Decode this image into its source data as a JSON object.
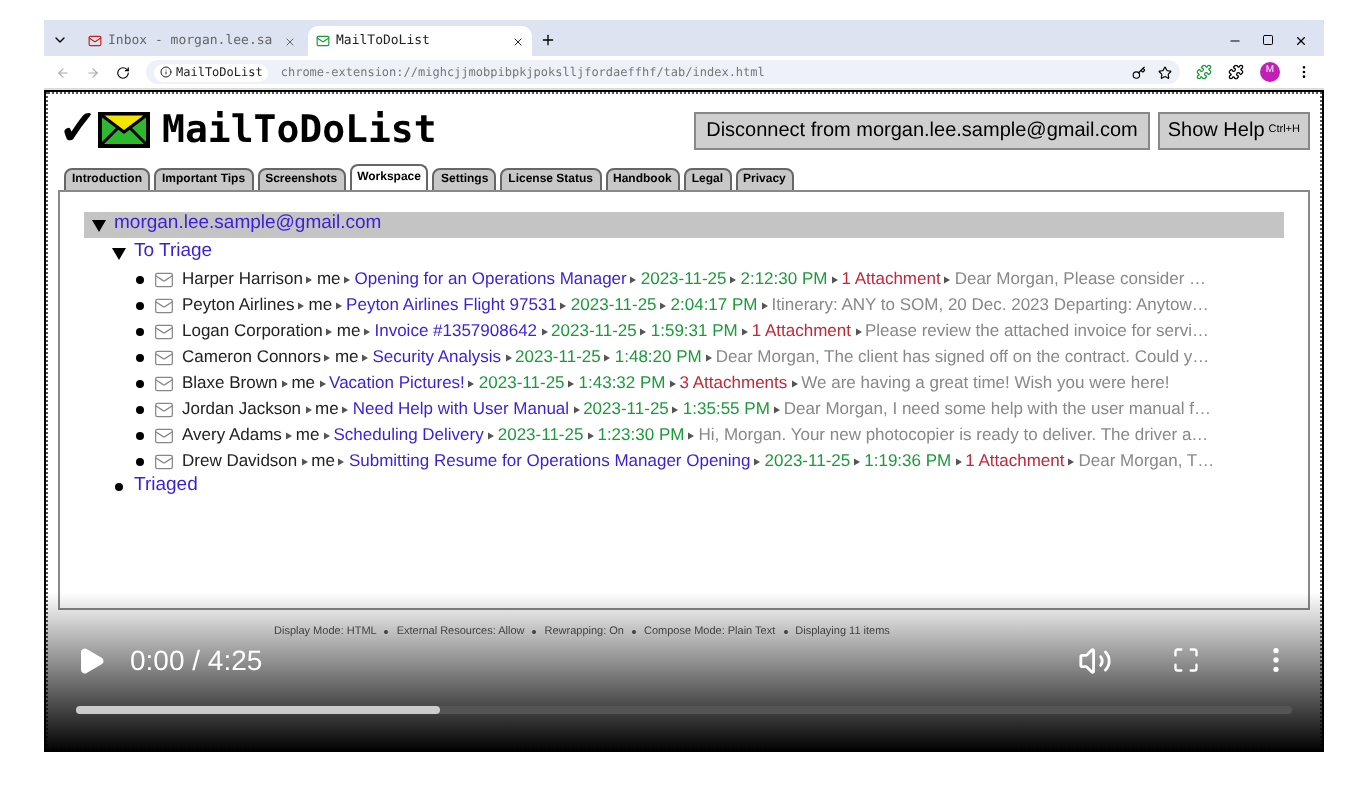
{
  "browser": {
    "tabs": [
      {
        "label": "Inbox - morgan.lee.sa",
        "selected": false
      },
      {
        "label": "MailToDoList",
        "selected": true
      }
    ],
    "site_chip": "MailToDoList",
    "url": "chrome-extension://mighcjjmobpibpkjpokslljfordaeffhf/tab/index.html",
    "profile": "M"
  },
  "app": {
    "check": "✓",
    "title": "MailToDoList",
    "disconnect_button": "Disconnect from morgan.lee.sample@gmail.com",
    "help_button": "Show Help",
    "help_shortcut": "Ctrl+H"
  },
  "tabs": [
    {
      "label": "Introduction",
      "selected": false
    },
    {
      "label": "Important Tips",
      "selected": false
    },
    {
      "label": "Screenshots",
      "selected": false
    },
    {
      "label": "Workspace",
      "selected": true
    },
    {
      "label": "Settings",
      "selected": false
    },
    {
      "label": "License Status",
      "selected": false
    },
    {
      "label": "Handbook",
      "selected": false
    },
    {
      "label": "Legal",
      "selected": false
    },
    {
      "label": "Privacy",
      "selected": false
    }
  ],
  "tree": {
    "account": "morgan.lee.sample@gmail.com",
    "expanded": true,
    "groups": [
      {
        "label": "To Triage",
        "expanded": true,
        "children": [
          {
            "sender": "Harper Harrison",
            "to": "me",
            "subject": "Opening for an Operations Manager",
            "date": "2023-11-25",
            "time": "2:12:30 PM",
            "attachments": "1 Attachment",
            "snippet": "Dear Morgan, Please consider …"
          },
          {
            "sender": "Peyton Airlines",
            "to": "me",
            "subject": "Peyton Airlines Flight 97531",
            "date": "2023-11-25",
            "time": "2:04:17 PM",
            "snippet": "Itinerary: ANY to SOM, 20 Dec. 2023 Departing: Anytow…"
          },
          {
            "sender": "Logan Corporation",
            "to": "me",
            "subject": "Invoice #1357908642",
            "date": "2023-11-25",
            "time": "1:59:31 PM",
            "attachments": "1 Attachment",
            "snippet": "Please review the attached invoice for servi…"
          },
          {
            "sender": "Cameron Connors",
            "to": "me",
            "subject": "Security Analysis",
            "date": "2023-11-25",
            "time": "1:48:20 PM",
            "snippet": "Dear Morgan, The client has signed off on the contract. Could y…"
          },
          {
            "sender": "Blaxe Brown",
            "to": "me",
            "subject": "Vacation Pictures!",
            "date": "2023-11-25",
            "time": "1:43:32 PM",
            "attachments": "3 Attachments",
            "snippet": "We are having a great time! Wish you were here!"
          },
          {
            "sender": "Jordan Jackson",
            "to": "me",
            "subject": "Need Help with User Manual",
            "date": "2023-11-25",
            "time": "1:35:55 PM",
            "snippet": "Dear Morgan, I need some help with the user manual f…"
          },
          {
            "sender": "Avery Adams",
            "to": "me",
            "subject": "Scheduling Delivery",
            "date": "2023-11-25",
            "time": "1:23:30 PM",
            "snippet": "Hi, Morgan. Your new photocopier is ready to deliver. The driver a…"
          },
          {
            "sender": "Drew Davidson",
            "to": "me",
            "subject": "Submitting Resume for Operations Manager Opening",
            "date": "2023-11-25",
            "time": "1:19:36 PM",
            "attachments": "1 Attachment",
            "snippet": "Dear Morgan, T…"
          }
        ]
      },
      {
        "label": "Triaged",
        "expanded": false
      }
    ]
  },
  "status_bar": [
    "Display Mode: HTML",
    "External Resources: Allow",
    "Rewrapping: On",
    "Compose Mode: Plain Text",
    "Displaying 11 items"
  ],
  "video": {
    "time": "0:00 / 4:25",
    "level": 0.3
  }
}
